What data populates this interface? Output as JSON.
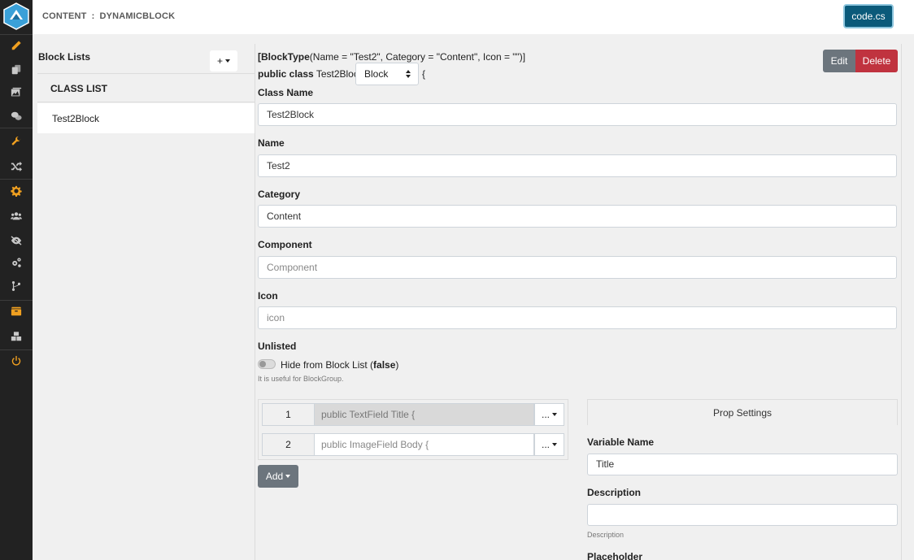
{
  "header": {
    "breadcrumb_section": "CONTENT",
    "breadcrumb_separator": ":",
    "breadcrumb_page": "DYNAMICBLOCK",
    "code_button": "code.cs"
  },
  "sidebar": {
    "items": [
      {
        "icon": "pencil-icon"
      },
      {
        "icon": "copy-icon"
      },
      {
        "icon": "images-icon"
      },
      {
        "icon": "comments-icon"
      },
      {
        "icon": "wrench-icon"
      },
      {
        "icon": "shuffle-icon"
      },
      {
        "icon": "gear-icon"
      },
      {
        "icon": "users-icon"
      },
      {
        "icon": "eye-slash-icon"
      },
      {
        "icon": "gears-icon"
      },
      {
        "icon": "code-branch-icon"
      },
      {
        "icon": "box-icon"
      },
      {
        "icon": "boxes-icon"
      },
      {
        "icon": "power-icon"
      }
    ]
  },
  "left_panel": {
    "title": "Block Lists",
    "add_button": "+",
    "class_list_header": "CLASS LIST",
    "items": [
      "Test2Block"
    ]
  },
  "main": {
    "attr_open": "[",
    "attr_name": "BlockType",
    "attr_args": "(Name = \"Test2\", Category = \"Content\", Icon = \"\")]",
    "class_keyword": "public class",
    "class_name": "Test2Block:",
    "base_type": "Block",
    "open_brace": "{",
    "edit_button": "Edit",
    "delete_button": "Delete",
    "fields": {
      "class_name_label": "Class Name",
      "class_name_value": "Test2Block",
      "name_label": "Name",
      "name_value": "Test2",
      "category_label": "Category",
      "category_value": "Content",
      "component_label": "Component",
      "component_placeholder": "Component",
      "icon_label": "Icon",
      "icon_placeholder": "icon",
      "unlisted_label": "Unlisted",
      "hide_text": "Hide from Block List (",
      "hide_value": "false",
      "hide_close": ")",
      "hint": "It is useful for BlockGroup."
    },
    "properties": [
      {
        "index": "1",
        "declaration": "public TextField Title {",
        "menu": "..."
      },
      {
        "index": "2",
        "declaration": "public ImageField Body {",
        "menu": "..."
      }
    ],
    "add_button": "Add",
    "prop_settings": {
      "title": "Prop Settings",
      "variable_name_label": "Variable Name",
      "variable_name_value": "Title",
      "description_label": "Description",
      "description_value": "",
      "description_hint": "Description",
      "placeholder_label": "Placeholder"
    }
  }
}
